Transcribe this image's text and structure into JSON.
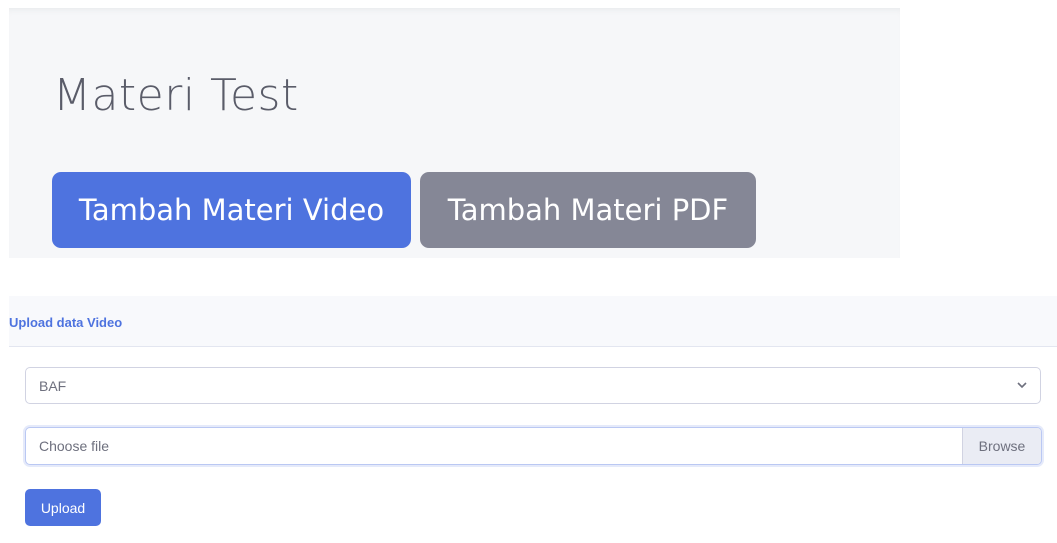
{
  "header": {
    "title": "Materi Test",
    "tabs": [
      {
        "label": "Tambah Materi Video",
        "active": true,
        "color": "#4e73df"
      },
      {
        "label": "Tambah Materi PDF",
        "active": false,
        "color": "#858796"
      }
    ]
  },
  "card": {
    "title": "Upload data Video",
    "select": {
      "value": "BAF",
      "icon": "chevron-down-icon"
    },
    "file": {
      "placeholder": "Choose file",
      "browse_label": "Browse"
    },
    "submit_label": "Upload"
  },
  "colors": {
    "primary": "#4e73df",
    "secondary": "#858796",
    "text": "#5a5c69"
  }
}
